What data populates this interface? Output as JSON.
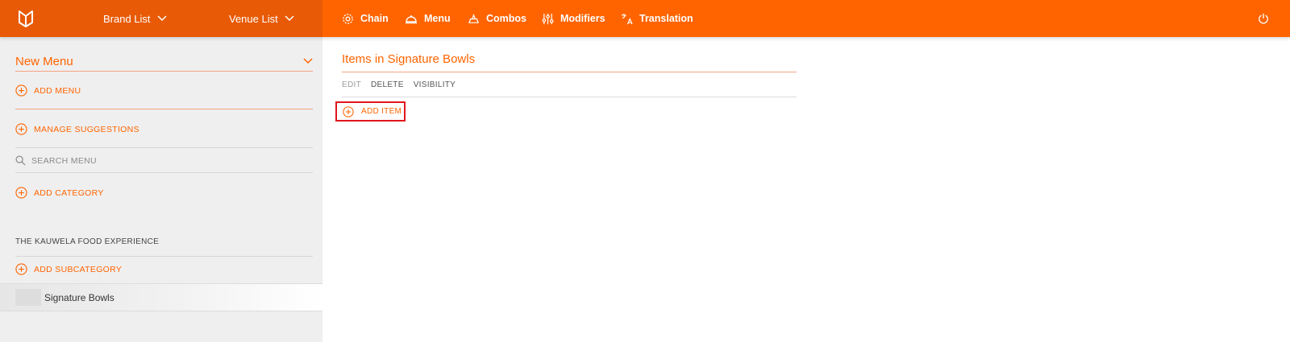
{
  "topbar": {
    "brand_list": "Brand List",
    "venue_list": "Venue List",
    "nav": [
      {
        "label": "Chain",
        "icon": "gear-icon"
      },
      {
        "label": "Menu",
        "icon": "cloche-icon"
      },
      {
        "label": "Combos",
        "icon": "combo-icon"
      },
      {
        "label": "Modifiers",
        "icon": "sliders-icon"
      },
      {
        "label": "Translation",
        "icon": "translate-icon"
      }
    ]
  },
  "sidebar": {
    "menu_select": "New Menu",
    "add_menu": "ADD MENU",
    "manage_suggestions": "MANAGE SUGGESTIONS",
    "search_placeholder": "SEARCH MENU",
    "add_category": "ADD CATEGORY",
    "category_name": "THE KAUWELA FOOD EXPERIENCE",
    "add_subcategory": "ADD SUBCATEGORY",
    "selected_subcategory": "Signature Bowls"
  },
  "main": {
    "title": "Items in Signature Bowls",
    "tabs": {
      "edit": "EDIT",
      "delete": "DELETE",
      "visibility": "VISIBILITY"
    },
    "add_item": "ADD ITEM"
  },
  "colors": {
    "accent": "#ff6400",
    "topbar_left": "#e85a05",
    "highlight": "#e0161c"
  }
}
